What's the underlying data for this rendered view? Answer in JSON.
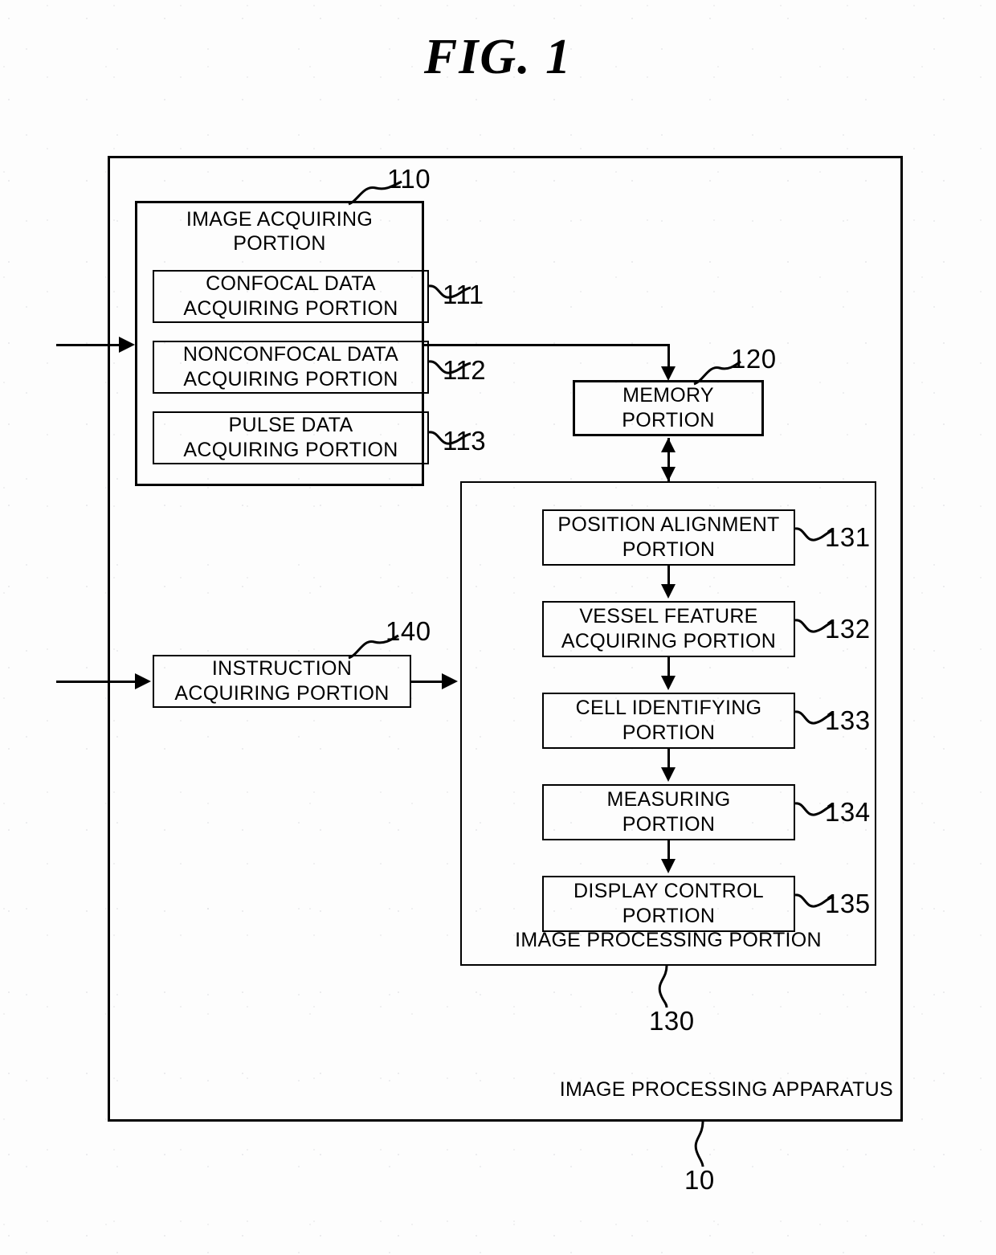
{
  "figure": {
    "title": "FIG.  1"
  },
  "apparatus": {
    "label": "IMAGE PROCESSING APPARATUS",
    "ref": "10"
  },
  "image_acquiring": {
    "label": "IMAGE ACQUIRING\nPORTION",
    "ref": "110",
    "children": [
      {
        "label": "CONFOCAL DATA\nACQUIRING PORTION",
        "ref": "111"
      },
      {
        "label": "NONCONFOCAL DATA\nACQUIRING PORTION",
        "ref": "112"
      },
      {
        "label": "PULSE DATA\nACQUIRING PORTION",
        "ref": "113"
      }
    ]
  },
  "memory": {
    "label": "MEMORY\nPORTION",
    "ref": "120"
  },
  "instruction": {
    "label": "INSTRUCTION\nACQUIRING PORTION",
    "ref": "140"
  },
  "image_processing": {
    "label": "IMAGE PROCESSING PORTION",
    "ref": "130",
    "children": [
      {
        "label": "POSITION ALIGNMENT\nPORTION",
        "ref": "131"
      },
      {
        "label": "VESSEL FEATURE\nACQUIRING PORTION",
        "ref": "132"
      },
      {
        "label": "CELL IDENTIFYING\nPORTION",
        "ref": "133"
      },
      {
        "label": "MEASURING\nPORTION",
        "ref": "134"
      },
      {
        "label": "DISPLAY CONTROL\nPORTION",
        "ref": "135"
      }
    ]
  },
  "colors": {
    "ink": "#000000",
    "paper": "#ffffff"
  }
}
